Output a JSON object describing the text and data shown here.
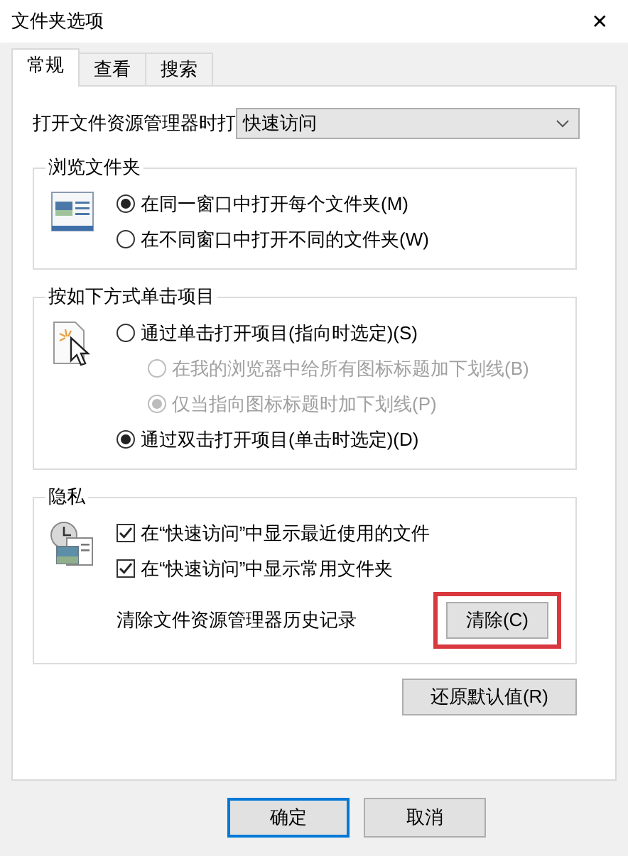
{
  "window": {
    "title": "文件夹选项",
    "close": "✕"
  },
  "tabs": [
    {
      "label": "常规",
      "selected": true
    },
    {
      "label": "查看",
      "selected": false
    },
    {
      "label": "搜索",
      "selected": false
    }
  ],
  "open_explorer": {
    "label": "打开文件资源管理器时打",
    "value": "快速访问"
  },
  "groups": [
    {
      "title": "浏览文件夹",
      "options": [
        {
          "kind": "radio",
          "label": "在同一窗口中打开每个文件夹(M)",
          "selected": true,
          "disabled": false
        },
        {
          "kind": "radio",
          "label": "在不同窗口中打开不同的文件夹(W)",
          "selected": false,
          "disabled": false
        }
      ]
    },
    {
      "title": "按如下方式单击项目",
      "options": [
        {
          "kind": "radio",
          "label": "通过单击打开项目(指向时选定)(S)",
          "selected": false,
          "disabled": false,
          "children": [
            {
              "kind": "radio",
              "label": "在我的浏览器中给所有图标标题加下划线(B)",
              "selected": false,
              "disabled": true
            },
            {
              "kind": "radio",
              "label": "仅当指向图标标题时加下划线(P)",
              "selected": true,
              "disabled": true
            }
          ]
        },
        {
          "kind": "radio",
          "label": "通过双击打开项目(单击时选定)(D)",
          "selected": true,
          "disabled": false
        }
      ]
    },
    {
      "title": "隐私",
      "options": [
        {
          "kind": "checkbox",
          "label": "在“快速访问”中显示最近使用的文件",
          "checked": true
        },
        {
          "kind": "checkbox",
          "label": "在“快速访问”中显示常用文件夹",
          "checked": true
        },
        {
          "kind": "action",
          "label": "清除文件资源管理器历史记录",
          "button": "清除(C)",
          "highlighted": true
        }
      ]
    }
  ],
  "restore_button": "还原默认值(R)",
  "footer_buttons": [
    {
      "label": "确定",
      "default": true
    },
    {
      "label": "取消",
      "default": false
    }
  ]
}
